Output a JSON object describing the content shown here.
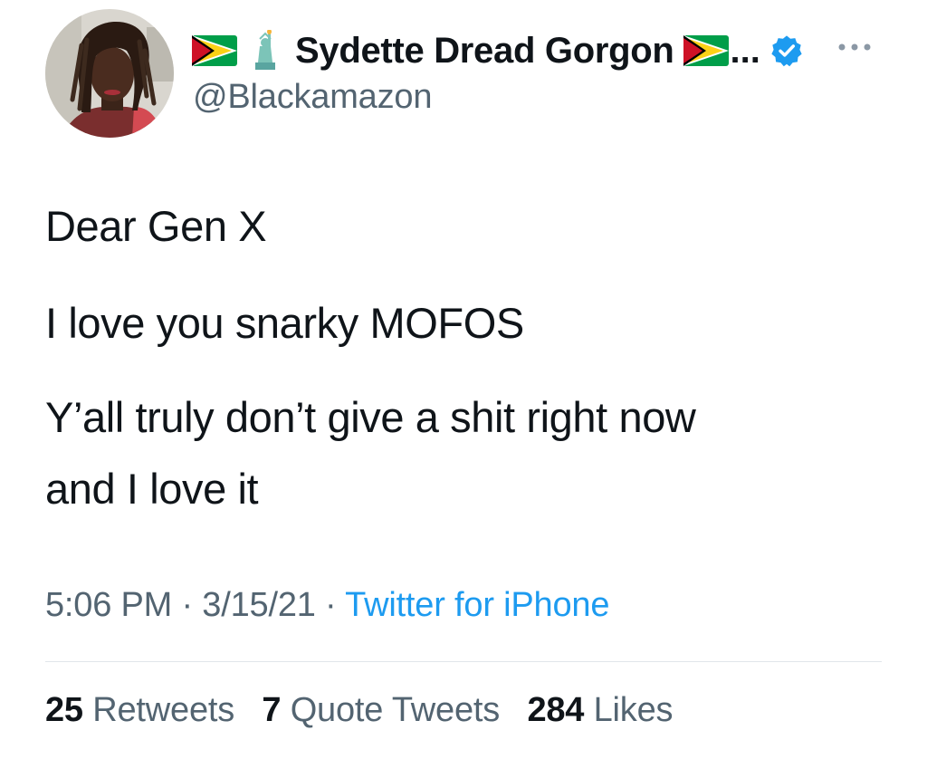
{
  "author": {
    "display_name": "Sydette Dread Gorgon",
    "truncation": "...",
    "handle": "@Blackamazon",
    "name_emojis_before": [
      "guyana-flag-icon",
      "statue-of-liberty-icon"
    ],
    "name_emojis_after": [
      "guyana-flag-icon"
    ],
    "verified": true
  },
  "tweet": {
    "lines": [
      "Dear Gen X",
      "I love you snarky MOFOS",
      "Y’all truly don’t give a shit right now",
      "and I love it"
    ]
  },
  "meta": {
    "time": "5:06 PM",
    "separator": " · ",
    "date": "3/15/21",
    "source": "Twitter for iPhone"
  },
  "stats": {
    "retweets_count": "25",
    "retweets_label": "Retweets",
    "quotes_count": "7",
    "quotes_label": "Quote Tweets",
    "likes_count": "284",
    "likes_label": "Likes"
  },
  "colors": {
    "text": "#0f1419",
    "secondary": "#536471",
    "link": "#1d9bf0",
    "verified": "#1d9bf0"
  }
}
